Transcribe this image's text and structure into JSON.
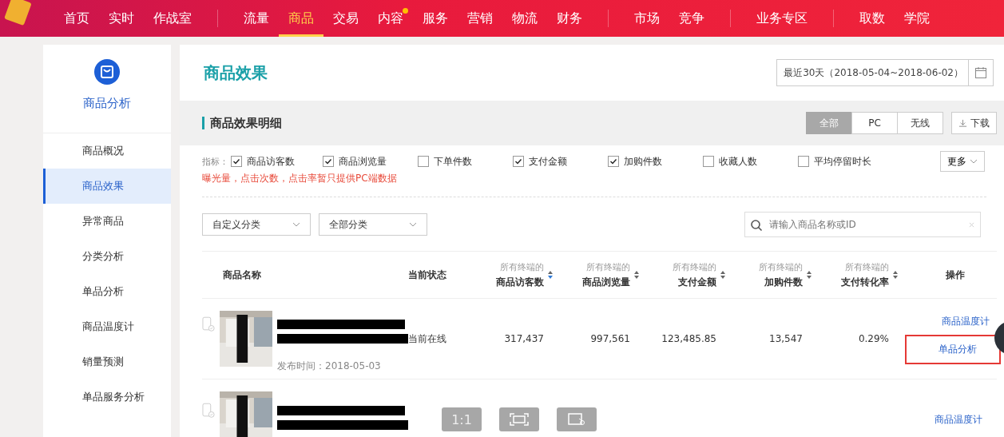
{
  "nav": [
    {
      "items": [
        {
          "label": "首页",
          "selected": false,
          "dot": false
        },
        {
          "label": "实时",
          "selected": false,
          "dot": false
        },
        {
          "label": "作战室",
          "selected": false,
          "dot": false
        }
      ]
    },
    {
      "items": [
        {
          "label": "流量",
          "selected": false,
          "dot": false
        },
        {
          "label": "商品",
          "selected": true,
          "dot": false
        },
        {
          "label": "交易",
          "selected": false,
          "dot": false
        },
        {
          "label": "内容",
          "selected": false,
          "dot": true
        },
        {
          "label": "服务",
          "selected": false,
          "dot": false
        },
        {
          "label": "营销",
          "selected": false,
          "dot": false
        },
        {
          "label": "物流",
          "selected": false,
          "dot": false
        },
        {
          "label": "财务",
          "selected": false,
          "dot": false
        }
      ]
    },
    {
      "items": [
        {
          "label": "市场",
          "selected": false,
          "dot": false
        },
        {
          "label": "竞争",
          "selected": false,
          "dot": false
        }
      ]
    },
    {
      "items": [
        {
          "label": "业务专区",
          "selected": false,
          "dot": false
        }
      ]
    },
    {
      "items": [
        {
          "label": "取数",
          "selected": false,
          "dot": false
        },
        {
          "label": "学院",
          "selected": false,
          "dot": false
        }
      ]
    }
  ],
  "sidebar": {
    "title": "商品分析",
    "items": [
      {
        "label": "商品概况",
        "selected": false
      },
      {
        "label": "商品效果",
        "selected": true
      },
      {
        "label": "异常商品",
        "selected": false
      },
      {
        "label": "分类分析",
        "selected": false
      },
      {
        "label": "单品分析",
        "selected": false
      },
      {
        "label": "商品温度计",
        "selected": false
      },
      {
        "label": "销量预测",
        "selected": false
      },
      {
        "label": "单品服务分析",
        "selected": false
      }
    ]
  },
  "page_title": "商品效果",
  "date_range": "最近30天（2018-05-04~2018-06-02）",
  "section": {
    "title": "商品效果明细",
    "segments": [
      {
        "label": "全部",
        "selected": true
      },
      {
        "label": "PC",
        "selected": false
      },
      {
        "label": "无线",
        "selected": false
      }
    ],
    "download": "下载"
  },
  "metrics": {
    "label": "指标：",
    "items": [
      {
        "label": "商品访客数",
        "checked": true
      },
      {
        "label": "商品浏览量",
        "checked": true
      },
      {
        "label": "下单件数",
        "checked": false
      },
      {
        "label": "支付金额",
        "checked": true
      },
      {
        "label": "加购件数",
        "checked": true
      },
      {
        "label": "收藏人数",
        "checked": false
      },
      {
        "label": "平均停留时长",
        "checked": false
      }
    ],
    "more": "更多",
    "note": "曝光量，点击次数，点击率暂只提供PC端数据"
  },
  "filters": [
    "自定义分类",
    "全部分类"
  ],
  "search": {
    "placeholder": "请输入商品名称或ID"
  },
  "table": {
    "columns": [
      {
        "label": "商品名称",
        "sortable": false
      },
      {
        "label": "当前状态",
        "sortable": false
      },
      {
        "top": "所有终端的",
        "label": "商品访客数",
        "sortable": true
      },
      {
        "top": "所有终端的",
        "label": "商品浏览量",
        "sortable": true
      },
      {
        "top": "所有终端的",
        "label": "支付金额",
        "sortable": true
      },
      {
        "top": "所有终端的",
        "label": "加购件数",
        "sortable": true
      },
      {
        "top": "所有终端的",
        "label": "支付转化率",
        "sortable": true
      },
      {
        "label": "操作",
        "sortable": false
      }
    ],
    "rows": [
      {
        "published": "发布时间：2018-05-03",
        "status": "当前在线",
        "values": [
          "317,437",
          "997,561",
          "123,485.85",
          "13,547",
          "0.29%"
        ],
        "actions": [
          "商品温度计",
          "单品分析"
        ]
      },
      {
        "actions": [
          "商品温度计"
        ]
      }
    ]
  },
  "viewer": {
    "zoom": "1:1"
  }
}
